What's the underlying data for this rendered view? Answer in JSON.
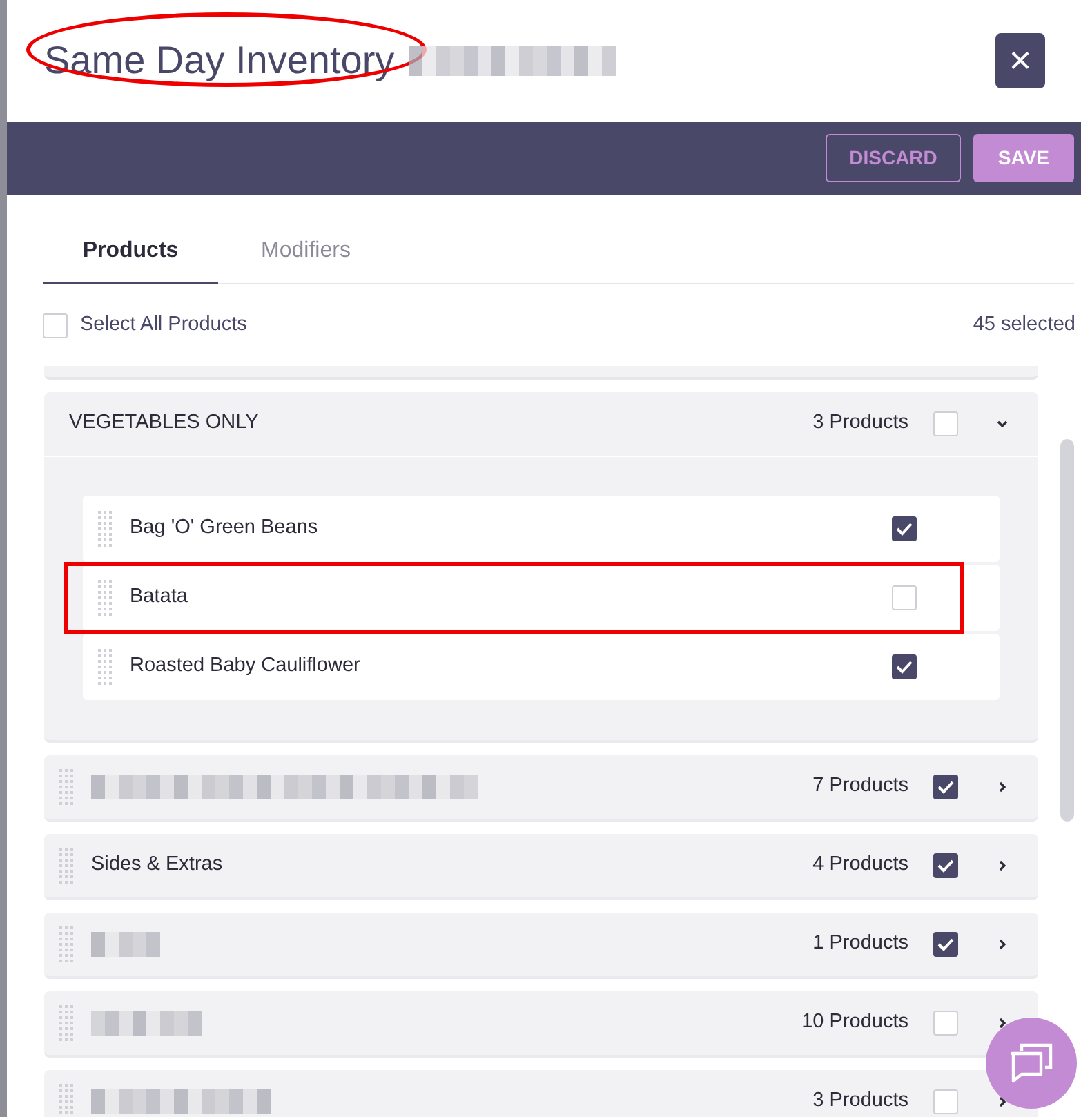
{
  "header": {
    "title": "Same Day Inventory",
    "title_circled": true,
    "title_suffix_redacted": true,
    "close_icon": "×"
  },
  "toolbar": {
    "buttons": [
      {
        "label": "DISCARD",
        "kind": "outline"
      },
      {
        "label": "SAVE",
        "kind": "filled"
      }
    ]
  },
  "tabs": [
    {
      "label": "Products",
      "selected": true
    },
    {
      "label": "Modifiers",
      "selected": false
    }
  ],
  "select_all": {
    "label": "Select All Products",
    "checked": false,
    "count": "45 selected"
  },
  "categories": [
    {
      "name": "VEGETABLES ONLY",
      "redacted": false,
      "count": "3 Products",
      "checked": false,
      "expanded": true,
      "items": [
        {
          "name": "Bag 'O' Green Beans",
          "checked": true,
          "highlighted": false
        },
        {
          "name": "Batata",
          "checked": false,
          "highlighted": true
        },
        {
          "name": "Roasted Baby Cauliflower",
          "checked": true,
          "highlighted": false
        }
      ]
    },
    {
      "redacted": true,
      "count": "7 Products",
      "checked": true,
      "expanded": false
    },
    {
      "name": "Sides & Extras",
      "redacted": false,
      "count": "4 Products",
      "checked": true,
      "expanded": false
    },
    {
      "redacted": true,
      "count": "1 Products",
      "checked": true,
      "expanded": false
    },
    {
      "redacted": true,
      "count": "10 Products",
      "checked": false,
      "expanded": false
    },
    {
      "redacted": true,
      "count": "3 Products",
      "checked": false,
      "expanded": false
    }
  ]
}
